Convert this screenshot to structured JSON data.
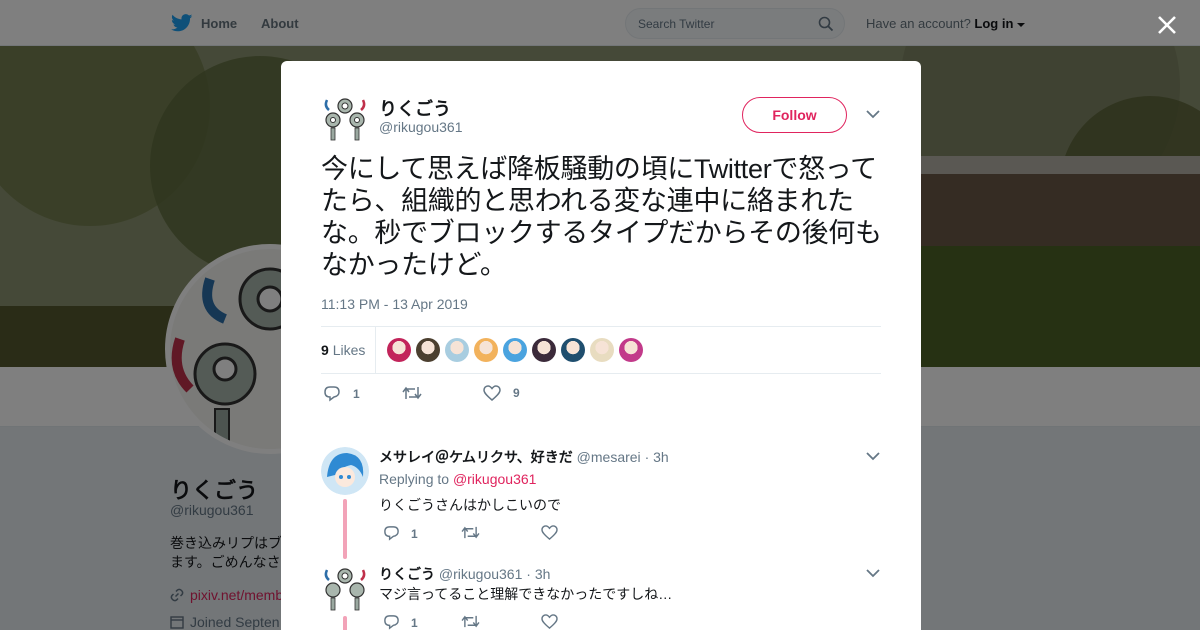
{
  "nav": {
    "home_label": "Home",
    "about_label": "About",
    "search_placeholder": "Search Twitter",
    "account_prompt": "Have an account?",
    "login_label": "Log in",
    "brand_color": "#1da1f2"
  },
  "profile": {
    "name": "りくごう",
    "handle": "@rikugou361",
    "bio": "巻き込みリプはブ\nます。ごめんなさ",
    "link": "pixiv.net/memb",
    "joined": "Joined Septen"
  },
  "tweet": {
    "author_name": "りくごう",
    "author_handle": "@rikugou361",
    "follow_label": "Follow",
    "text": "今にして思えば降板騒動の頃にTwitterで怒ってたら、組織的と思われる変な連中に絡まれたな。秒でブロックするタイプだからその後何もなかったけど。",
    "timestamp": "11:13 PM - 13 Apr 2019",
    "likes_count": "9",
    "likes_label": "Likes",
    "reply_count": "1",
    "retweet_count": "",
    "like_count": "9",
    "accent_color": "#e0245e",
    "liker_avatar_colors": [
      "#c2245a",
      "#4b3f2f",
      "#a8cde0",
      "#f2b25c",
      "#4aa3df",
      "#3b2a3a",
      "#1f4e6e",
      "#e8dcc0",
      "#c23a8a"
    ]
  },
  "replies": [
    {
      "author_name": "メサレイ＠ケムリクサ、好きだ",
      "author_handle": "@mesarei",
      "time": "· 3h",
      "replying_prefix": "Replying to",
      "replying_to": "@rikugou361",
      "text": "りくごうさんはかしこいので",
      "reply_count": "1",
      "retweet_count": "",
      "like_count": ""
    },
    {
      "author_name": "りくごう",
      "author_handle": "@rikugou361",
      "time": "· 3h",
      "text": "マジ言ってること理解できなかったですしね…",
      "reply_count": "1",
      "retweet_count": "",
      "like_count": ""
    }
  ]
}
